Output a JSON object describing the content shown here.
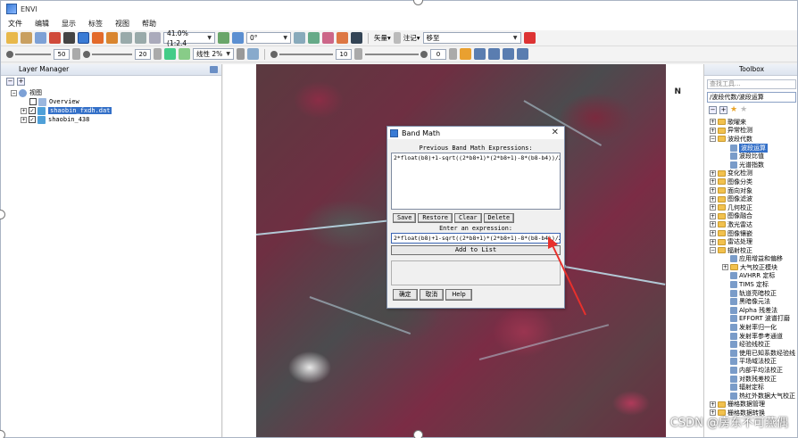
{
  "window": {
    "title": "ENVI"
  },
  "menu": [
    "文件",
    "编辑",
    "显示",
    "标签",
    "视图",
    "帮助"
  ],
  "toolbar": {
    "zoom": "41.0% (1:2.4",
    "rotation": "0°",
    "annotation_label": "注记",
    "vector_label": "矢量",
    "place_field": "移至",
    "stretch": "线性 2%",
    "brightness": "50",
    "contrast": "20",
    "sharpen": "10",
    "transparency": "0"
  },
  "layer_manager": {
    "title": "Layer Manager",
    "root": "视图",
    "overview": "Overview",
    "layers": [
      "shaobin_fxdh.dat",
      "shaobin_438"
    ]
  },
  "image": {
    "north_label": "N"
  },
  "toolbox": {
    "title": "Toolbox",
    "search_placeholder": "查找工具...",
    "path": "/波段代数/波段运算",
    "items": [
      {
        "label": "歌曜来",
        "level": 0,
        "kind": "folder",
        "exp": "+"
      },
      {
        "label": "异常检测",
        "level": 0,
        "kind": "folder",
        "exp": "+"
      },
      {
        "label": "波段代数",
        "level": 0,
        "kind": "folder",
        "exp": "-"
      },
      {
        "label": "波段运算",
        "level": 1,
        "kind": "tool",
        "selected": true
      },
      {
        "label": "波段比值",
        "level": 1,
        "kind": "tool"
      },
      {
        "label": "光谱指数",
        "level": 1,
        "kind": "tool"
      },
      {
        "label": "变化检测",
        "level": 0,
        "kind": "folder",
        "exp": "+"
      },
      {
        "label": "图像分类",
        "level": 0,
        "kind": "folder",
        "exp": "+"
      },
      {
        "label": "面向对象",
        "level": 0,
        "kind": "folder",
        "exp": "+"
      },
      {
        "label": "图像滤波",
        "level": 0,
        "kind": "folder",
        "exp": "+"
      },
      {
        "label": "几何校正",
        "level": 0,
        "kind": "folder",
        "exp": "+"
      },
      {
        "label": "图像融合",
        "level": 0,
        "kind": "folder",
        "exp": "+"
      },
      {
        "label": "激光雷达",
        "level": 0,
        "kind": "folder",
        "exp": "+"
      },
      {
        "label": "图像镶嵌",
        "level": 0,
        "kind": "folder",
        "exp": "+"
      },
      {
        "label": "雷达处理",
        "level": 0,
        "kind": "folder",
        "exp": "+"
      },
      {
        "label": "辐射校正",
        "level": 0,
        "kind": "folder",
        "exp": "-"
      },
      {
        "label": "应用增益和偏移",
        "level": 1,
        "kind": "tool"
      },
      {
        "label": "大气校正模块",
        "level": 1,
        "kind": "folder",
        "exp": "+"
      },
      {
        "label": "AVHRR 定标",
        "level": 1,
        "kind": "tool"
      },
      {
        "label": "TIMS 定标",
        "level": 1,
        "kind": "tool"
      },
      {
        "label": "轨道亮暗校正",
        "level": 1,
        "kind": "tool"
      },
      {
        "label": "黑暗像元法",
        "level": 1,
        "kind": "tool"
      },
      {
        "label": "Alpha 残差法",
        "level": 1,
        "kind": "tool"
      },
      {
        "label": "EFFORT 波谱打磨",
        "level": 1,
        "kind": "tool"
      },
      {
        "label": "发射率归一化",
        "level": 1,
        "kind": "tool"
      },
      {
        "label": "发射率参考通道",
        "level": 1,
        "kind": "tool"
      },
      {
        "label": "经验线校正",
        "level": 1,
        "kind": "tool"
      },
      {
        "label": "使用已知系数经验线",
        "level": 1,
        "kind": "tool"
      },
      {
        "label": "平场域法校正",
        "level": 1,
        "kind": "tool"
      },
      {
        "label": "内部平均法校正",
        "level": 1,
        "kind": "tool"
      },
      {
        "label": "对数残差校正",
        "level": 1,
        "kind": "tool"
      },
      {
        "label": "辐射定标",
        "level": 1,
        "kind": "tool"
      },
      {
        "label": "热红外数据大气校正",
        "level": 1,
        "kind": "tool"
      },
      {
        "label": "栅格数据管理",
        "level": 0,
        "kind": "folder",
        "exp": "+"
      },
      {
        "label": "栅格数据转换",
        "level": 0,
        "kind": "folder",
        "exp": "+"
      }
    ]
  },
  "dialog": {
    "title": "Band Math",
    "previous_label": "Previous Band Math Expressions:",
    "previous_expression": "2*float(b8)+1-sqrt((2*b8+1)*(2*b8+1)-8*(b8-b4))/2",
    "buttons": [
      "Save",
      "Restore",
      "Clear",
      "Delete"
    ],
    "enter_label": "Enter an expression:",
    "expression": "2*float(b8)+1-sqrt((2*b8+1)*(2*b8+1)-8*(b8-b4))/2",
    "add_label": "Add to List",
    "ok": "确定",
    "cancel": "取消",
    "help": "Help"
  },
  "watermark": "CSDN @房东不可燕偶",
  "colors": {
    "selection": "#3470c8",
    "arrow": "#e8302c"
  }
}
